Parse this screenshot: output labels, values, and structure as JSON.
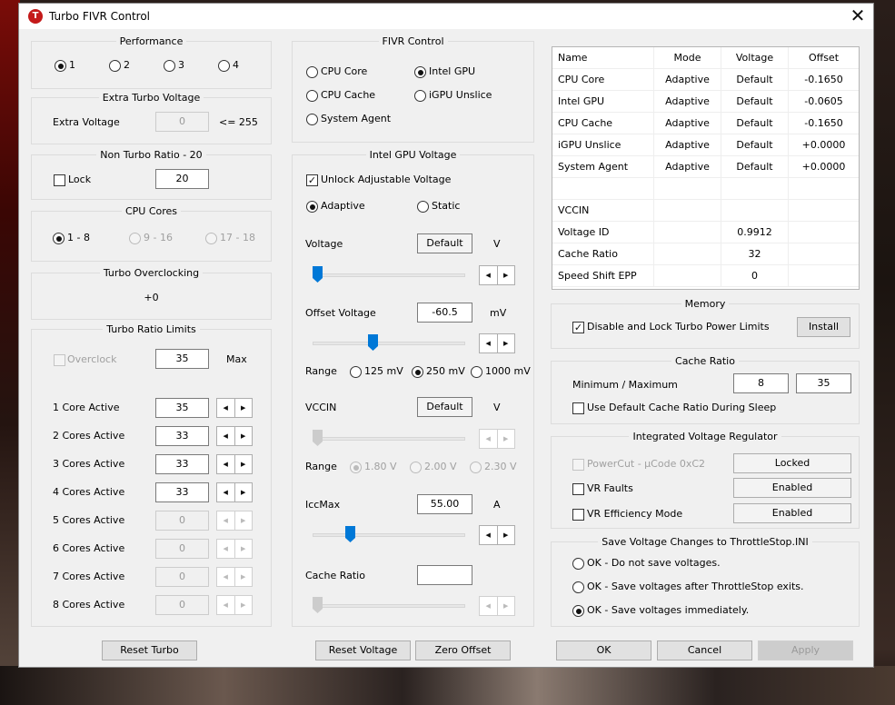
{
  "window": {
    "title": "Turbo FIVR Control",
    "close": "✕",
    "icon_letter": "T"
  },
  "performance": {
    "title": "Performance",
    "options": [
      "1",
      "2",
      "3",
      "4"
    ],
    "selected": 0
  },
  "extra_turbo": {
    "title": "Extra Turbo Voltage",
    "label": "Extra Voltage",
    "value": "0",
    "limit": "<= 255"
  },
  "non_turbo": {
    "title": "Non Turbo Ratio - 20",
    "lock_label": "Lock",
    "lock_checked": false,
    "value": "20"
  },
  "cpu_cores": {
    "title": "CPU Cores",
    "options": [
      "1 - 8",
      "9 - 16",
      "17 - 18"
    ],
    "selected": 0
  },
  "turbo_oc": {
    "title": "Turbo Overclocking",
    "value": "+0"
  },
  "turbo_ratio": {
    "title": "Turbo Ratio Limits",
    "overclock_label": "Overclock",
    "overclock_value": "35",
    "max_label": "Max",
    "rows": [
      {
        "label": "1 Core Active",
        "value": "35",
        "enabled": true
      },
      {
        "label": "2 Cores Active",
        "value": "33",
        "enabled": true
      },
      {
        "label": "3 Cores Active",
        "value": "33",
        "enabled": true
      },
      {
        "label": "4 Cores Active",
        "value": "33",
        "enabled": true
      },
      {
        "label": "5 Cores Active",
        "value": "0",
        "enabled": false
      },
      {
        "label": "6 Cores Active",
        "value": "0",
        "enabled": false
      },
      {
        "label": "7 Cores Active",
        "value": "0",
        "enabled": false
      },
      {
        "label": "8 Cores Active",
        "value": "0",
        "enabled": false
      }
    ]
  },
  "fivr": {
    "title": "FIVR Control",
    "options": {
      "cpu_core": "CPU Core",
      "intel_gpu": "Intel GPU",
      "cpu_cache": "CPU Cache",
      "igpu_unslice": "iGPU Unslice",
      "system_agent": "System Agent"
    },
    "selected": "intel_gpu"
  },
  "gpu_voltage": {
    "title": "Intel GPU Voltage",
    "unlock_label": "Unlock Adjustable Voltage",
    "unlock_checked": true,
    "mode_adaptive": "Adaptive",
    "mode_static": "Static",
    "mode_selected": "adaptive",
    "voltage_label": "Voltage",
    "voltage_value": "Default",
    "voltage_unit": "V",
    "offset_label": "Offset Voltage",
    "offset_value": "-60.5",
    "offset_unit": "mV",
    "offset_slider_fraction": 0.39,
    "range_label": "Range",
    "range_options": [
      "125 mV",
      "250 mV",
      "1000 mV"
    ],
    "range_selected": 1,
    "vccin_label": "VCCIN",
    "vccin_value": "Default",
    "vccin_unit": "V",
    "vccin_range_label": "Range",
    "vccin_range_options": [
      "1.80 V",
      "2.00 V",
      "2.30 V"
    ],
    "vccin_range_selected": 0,
    "iccmax_label": "IccMax",
    "iccmax_value": "55.00",
    "iccmax_unit": "A",
    "iccmax_slider_fraction": 0.23,
    "cache_ratio_label": "Cache Ratio",
    "cache_ratio_value": ""
  },
  "table": {
    "headers": [
      "Name",
      "Mode",
      "Voltage",
      "Offset"
    ],
    "rows": [
      [
        "CPU Core",
        "Adaptive",
        "Default",
        "-0.1650"
      ],
      [
        "Intel GPU",
        "Adaptive",
        "Default",
        "-0.0605"
      ],
      [
        "CPU Cache",
        "Adaptive",
        "Default",
        "-0.1650"
      ],
      [
        "iGPU Unslice",
        "Adaptive",
        "Default",
        "+0.0000"
      ],
      [
        "System Agent",
        "Adaptive",
        "Default",
        "+0.0000"
      ],
      [
        "",
        "",
        "",
        ""
      ],
      [
        "VCCIN",
        "",
        "",
        ""
      ],
      [
        "Voltage ID",
        "",
        "0.9912",
        ""
      ],
      [
        "Cache Ratio",
        "",
        "32",
        ""
      ],
      [
        "Speed Shift EPP",
        "",
        "0",
        ""
      ]
    ]
  },
  "memory": {
    "title": "Memory",
    "disable_label": "Disable and Lock Turbo Power Limits",
    "disable_checked": true,
    "install_label": "Install"
  },
  "cache_ratio": {
    "title": "Cache Ratio",
    "label": "Minimum / Maximum",
    "min": "8",
    "max": "35",
    "sleep_label": "Use Default Cache Ratio During Sleep",
    "sleep_checked": false
  },
  "ivr": {
    "title": "Integrated Voltage Regulator",
    "powercut_label": "PowerCut  -  µCode 0xC2",
    "powercut_btn": "Locked",
    "vr_faults_label": "VR Faults",
    "vr_faults_btn": "Enabled",
    "vr_eff_label": "VR Efficiency Mode",
    "vr_eff_btn": "Enabled"
  },
  "save": {
    "title": "Save Voltage Changes to ThrottleStop.INI",
    "options": [
      "OK - Do not save voltages.",
      "OK - Save voltages after ThrottleStop exits.",
      "OK - Save voltages immediately."
    ],
    "selected": 2
  },
  "buttons": {
    "reset_turbo": "Reset Turbo",
    "reset_voltage": "Reset Voltage",
    "zero_offset": "Zero Offset",
    "ok": "OK",
    "cancel": "Cancel",
    "apply": "Apply"
  },
  "colors": {
    "accent": "#0078d7",
    "app_icon": "#c41a1a"
  }
}
